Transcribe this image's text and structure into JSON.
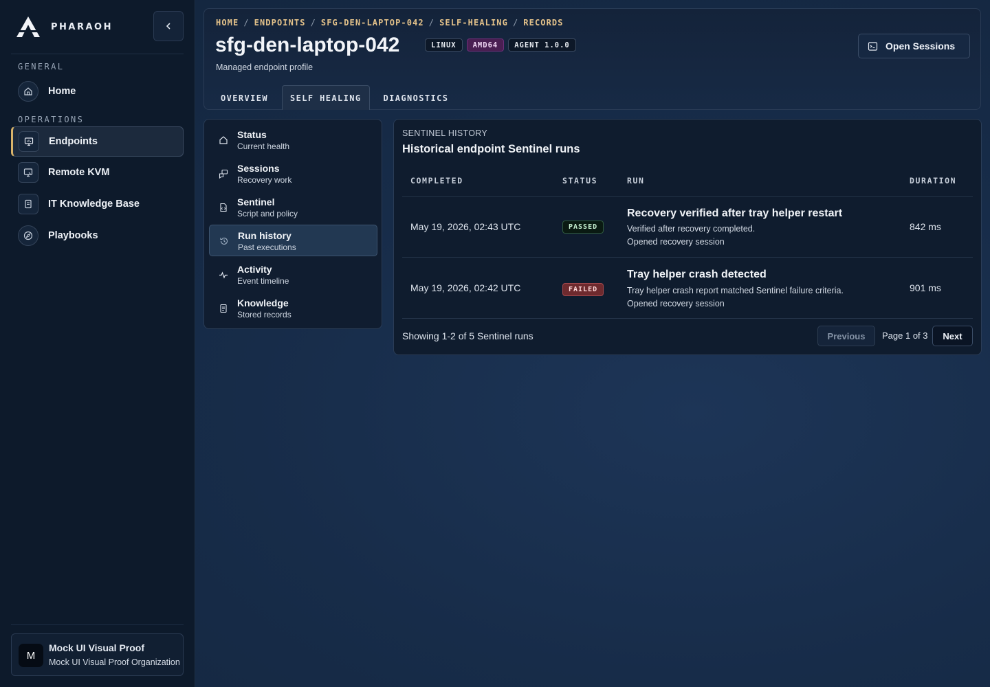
{
  "brand": {
    "name": "PHARAOH"
  },
  "sidebar": {
    "sections": [
      {
        "label": "GENERAL"
      },
      {
        "label": "OPERATIONS"
      }
    ],
    "items": [
      {
        "label": "Home",
        "icon": "home-icon"
      },
      {
        "label": "Endpoints",
        "icon": "monitor-icon",
        "active": true
      },
      {
        "label": "Remote KVM",
        "icon": "remote-desktop-icon"
      },
      {
        "label": "IT Knowledge Base",
        "icon": "book-icon"
      },
      {
        "label": "Playbooks",
        "icon": "compass-icon"
      }
    ],
    "org": {
      "avatar": "M",
      "name": "Mock UI Visual Proof",
      "subtitle": "Mock UI Visual Proof Organization"
    }
  },
  "header": {
    "breadcrumb": [
      "HOME",
      "ENDPOINTS",
      "SFG-DEN-LAPTOP-042",
      "SELF-HEALING",
      "RECORDS"
    ],
    "title": "sfg-den-laptop-042",
    "badges": [
      "LINUX",
      "AMD64",
      "AGENT 1.0.0"
    ],
    "subtitle": "Managed endpoint profile",
    "tabs": [
      "OVERVIEW",
      "SELF HEALING",
      "DIAGNOSTICS"
    ],
    "active_tab": "SELF HEALING",
    "open_sessions_label": "Open Sessions"
  },
  "subnav": [
    {
      "title": "Status",
      "desc": "Current health",
      "icon": "home-icon"
    },
    {
      "title": "Sessions",
      "desc": "Recovery work",
      "icon": "chat-icon"
    },
    {
      "title": "Sentinel",
      "desc": "Script and policy",
      "icon": "file-script-icon"
    },
    {
      "title": "Run history",
      "desc": "Past executions",
      "icon": "history-icon",
      "active": true
    },
    {
      "title": "Activity",
      "desc": "Event timeline",
      "icon": "pulse-icon"
    },
    {
      "title": "Knowledge",
      "desc": "Stored records",
      "icon": "document-icon"
    }
  ],
  "panel": {
    "eyebrow": "SENTINEL HISTORY",
    "title": "Historical endpoint Sentinel runs",
    "columns": [
      "COMPLETED",
      "STATUS",
      "RUN",
      "DURATION"
    ],
    "rows": [
      {
        "completed": "May 19, 2026, 02:43 UTC",
        "status": "PASSED",
        "run_title": "Recovery verified after tray helper restart",
        "run_line1": "Verified after recovery completed.",
        "run_line2": "Opened recovery session",
        "duration": "842 ms"
      },
      {
        "completed": "May 19, 2026, 02:42 UTC",
        "status": "FAILED",
        "run_title": "Tray helper crash detected",
        "run_line1": "Tray helper crash report matched Sentinel failure criteria.",
        "run_line2": "Opened recovery session",
        "duration": "901 ms"
      }
    ],
    "footer": "Showing 1-2 of 5 Sentinel runs",
    "pagination": {
      "prev": "Previous",
      "page": "Page 1 of 3",
      "next": "Next"
    }
  },
  "colors": {
    "accent": "#d9b36a",
    "passed": "#2f5a3e",
    "failed": "#6e2a2e",
    "badge_purple": "#4a1f52"
  }
}
